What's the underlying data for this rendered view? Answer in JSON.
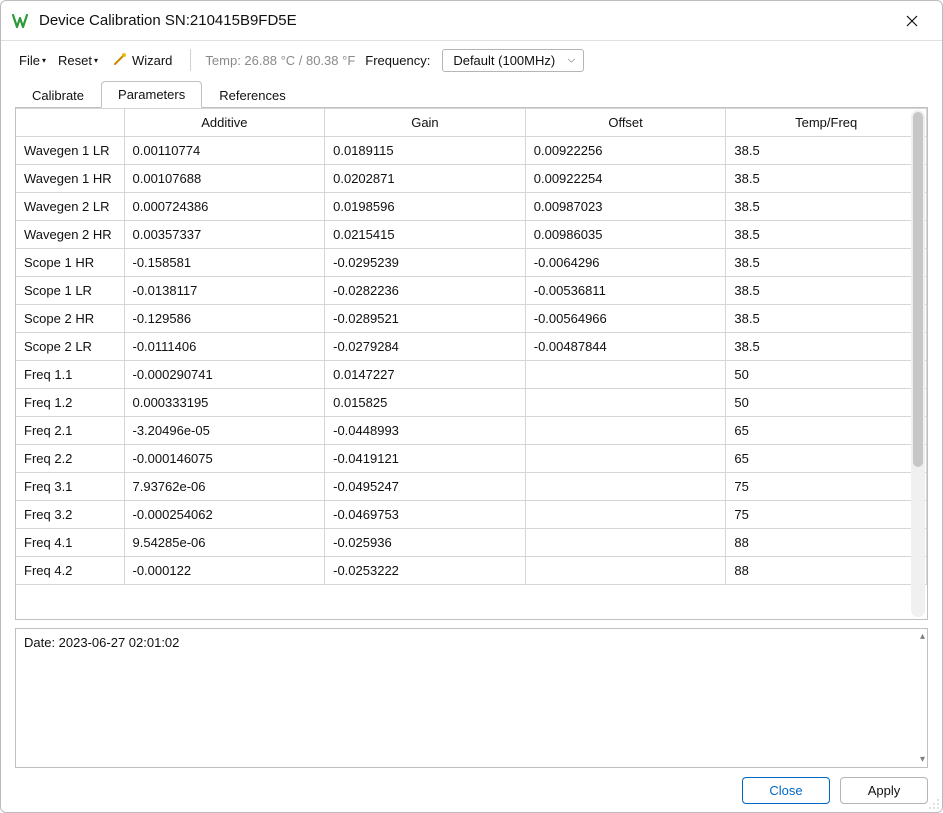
{
  "window": {
    "title": "Device Calibration SN:210415B9FD5E"
  },
  "toolbar": {
    "file_label": "File",
    "reset_label": "Reset",
    "wizard_label": "Wizard",
    "temp_text": "Temp: 26.88 °C / 80.38 °F",
    "frequency_label": "Frequency:",
    "frequency_value": "Default (100MHz)"
  },
  "tabs": [
    {
      "label": "Calibrate"
    },
    {
      "label": "Parameters"
    },
    {
      "label": "References"
    }
  ],
  "table": {
    "headers": [
      "",
      "Additive",
      "Gain",
      "Offset",
      "Temp/Freq"
    ],
    "rows": [
      {
        "name": "Wavegen 1 LR",
        "additive": "0.00110774",
        "gain": "0.0189115",
        "offset": "0.00922256",
        "tf": "38.5"
      },
      {
        "name": "Wavegen 1 HR",
        "additive": "0.00107688",
        "gain": "0.0202871",
        "offset": "0.00922254",
        "tf": "38.5"
      },
      {
        "name": "Wavegen 2 LR",
        "additive": "0.000724386",
        "gain": "0.0198596",
        "offset": "0.00987023",
        "tf": "38.5"
      },
      {
        "name": "Wavegen 2 HR",
        "additive": "0.00357337",
        "gain": "0.0215415",
        "offset": "0.00986035",
        "tf": "38.5"
      },
      {
        "name": "Scope 1 HR",
        "additive": "-0.158581",
        "gain": "-0.0295239",
        "offset": "-0.0064296",
        "tf": "38.5"
      },
      {
        "name": "Scope 1 LR",
        "additive": "-0.0138117",
        "gain": "-0.0282236",
        "offset": "-0.00536811",
        "tf": "38.5"
      },
      {
        "name": "Scope 2 HR",
        "additive": "-0.129586",
        "gain": "-0.0289521",
        "offset": "-0.00564966",
        "tf": "38.5"
      },
      {
        "name": "Scope 2 LR",
        "additive": "-0.0111406",
        "gain": "-0.0279284",
        "offset": "-0.00487844",
        "tf": "38.5"
      },
      {
        "name": "Freq 1.1",
        "additive": "-0.000290741",
        "gain": "0.0147227",
        "offset": "",
        "tf": "50"
      },
      {
        "name": "Freq 1.2",
        "additive": "0.000333195",
        "gain": "0.015825",
        "offset": "",
        "tf": "50"
      },
      {
        "name": "Freq 2.1",
        "additive": "-3.20496e-05",
        "gain": "-0.0448993",
        "offset": "",
        "tf": "65"
      },
      {
        "name": "Freq 2.2",
        "additive": "-0.000146075",
        "gain": "-0.0419121",
        "offset": "",
        "tf": "65"
      },
      {
        "name": "Freq 3.1",
        "additive": "7.93762e-06",
        "gain": "-0.0495247",
        "offset": "",
        "tf": "75"
      },
      {
        "name": "Freq 3.2",
        "additive": "-0.000254062",
        "gain": "-0.0469753",
        "offset": "",
        "tf": "75"
      },
      {
        "name": "Freq 4.1",
        "additive": "9.54285e-06",
        "gain": "-0.025936",
        "offset": "",
        "tf": "88"
      },
      {
        "name": "Freq 4.2",
        "additive": "-0.000122",
        "gain": "-0.0253222",
        "offset": "",
        "tf": "88"
      }
    ]
  },
  "log": {
    "text": "Date: 2023-06-27 02:01:02"
  },
  "buttons": {
    "close": "Close",
    "apply": "Apply"
  }
}
